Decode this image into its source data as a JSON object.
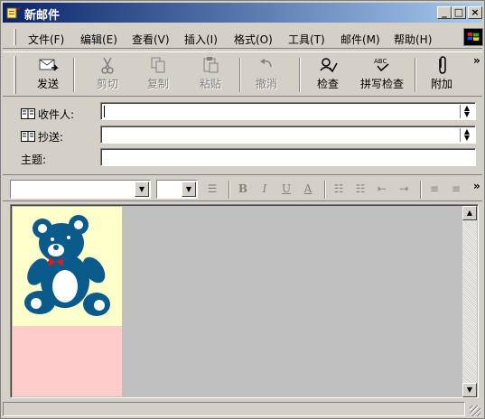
{
  "window": {
    "title": "新邮件",
    "controls": [
      "_",
      "□",
      "×"
    ]
  },
  "menu": [
    "文件(F)",
    "编辑(E)",
    "查看(V)",
    "插入(I)",
    "格式(O)",
    "工具(T)",
    "邮件(M)",
    "帮助(H)"
  ],
  "toolbar": {
    "send": "发送",
    "cut": "剪切",
    "copy": "复制",
    "paste": "粘贴",
    "undo": "撤消",
    "check": "检查",
    "spell_check": "拼写检查",
    "spell_icon_text": "ABC",
    "attach": "附加",
    "more": "»"
  },
  "header": {
    "to_label": "收件人:",
    "cc_label": "抄送:",
    "subject_label": "主题:",
    "to_value": "",
    "cc_value": "",
    "subject_value": ""
  },
  "format": {
    "bold": "B",
    "italic": "I",
    "underline": "U",
    "font_color": "A",
    "more": "»"
  },
  "colors": {
    "title_start": "#0a246a",
    "title_end": "#a6caf0",
    "bear": "#0a5a8c",
    "bear_pane": "#ffffcc",
    "pink_pane": "#ffcccc",
    "body_bg": "#c0c0c0"
  },
  "icons": [
    "envelope-icon",
    "scissors-icon",
    "copy-icon",
    "paste-icon",
    "undo-icon",
    "check-names-icon",
    "spellcheck-icon",
    "paperclip-icon",
    "address-book-icon",
    "windows-logo-icon"
  ]
}
